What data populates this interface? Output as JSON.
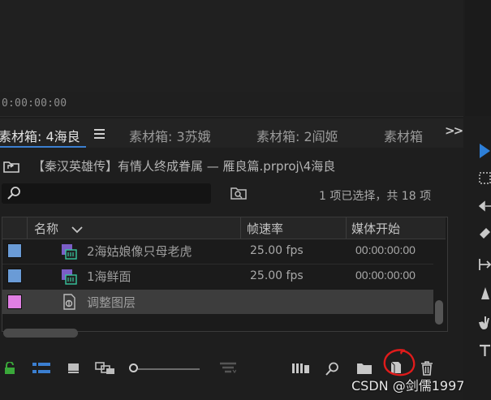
{
  "monitor": {
    "timecode": "0:00:00:00"
  },
  "tabs": {
    "active": "素材箱: 4海良",
    "items": [
      "素材箱: 3苏娥",
      "素材箱: 2阎姬",
      "素材箱"
    ],
    "overflow": ">>"
  },
  "path": "【秦汉英雄传】有情人终成眷属 — 雁良篇.prproj\\4海良",
  "search": {
    "placeholder": ""
  },
  "selection_status": "1 项已选择，共 18 项",
  "columns": {
    "name": "名称",
    "fps": "帧速率",
    "media_start": "媒体开始"
  },
  "rows": [
    {
      "name": "2海姑娘像只母老虎",
      "fps": "25.00 fps",
      "start": "00:00:00:00",
      "color": "#6a9bd6",
      "icon": "sequence-icon"
    },
    {
      "name": "1海鲜面",
      "fps": "25.00 fps",
      "start": "00:00:00:00",
      "color": "#6a9bd6",
      "icon": "sequence-icon"
    },
    {
      "name": "调整图层",
      "fps": "",
      "start": "",
      "color": "#e07fe3",
      "icon": "adjustment-layer-icon"
    }
  ],
  "watermark": "CSDN @剑儒1997",
  "colors": {
    "accent": "#3b7fd1",
    "annotation": "#e01b1b",
    "lock_green": "#3aa83a"
  }
}
